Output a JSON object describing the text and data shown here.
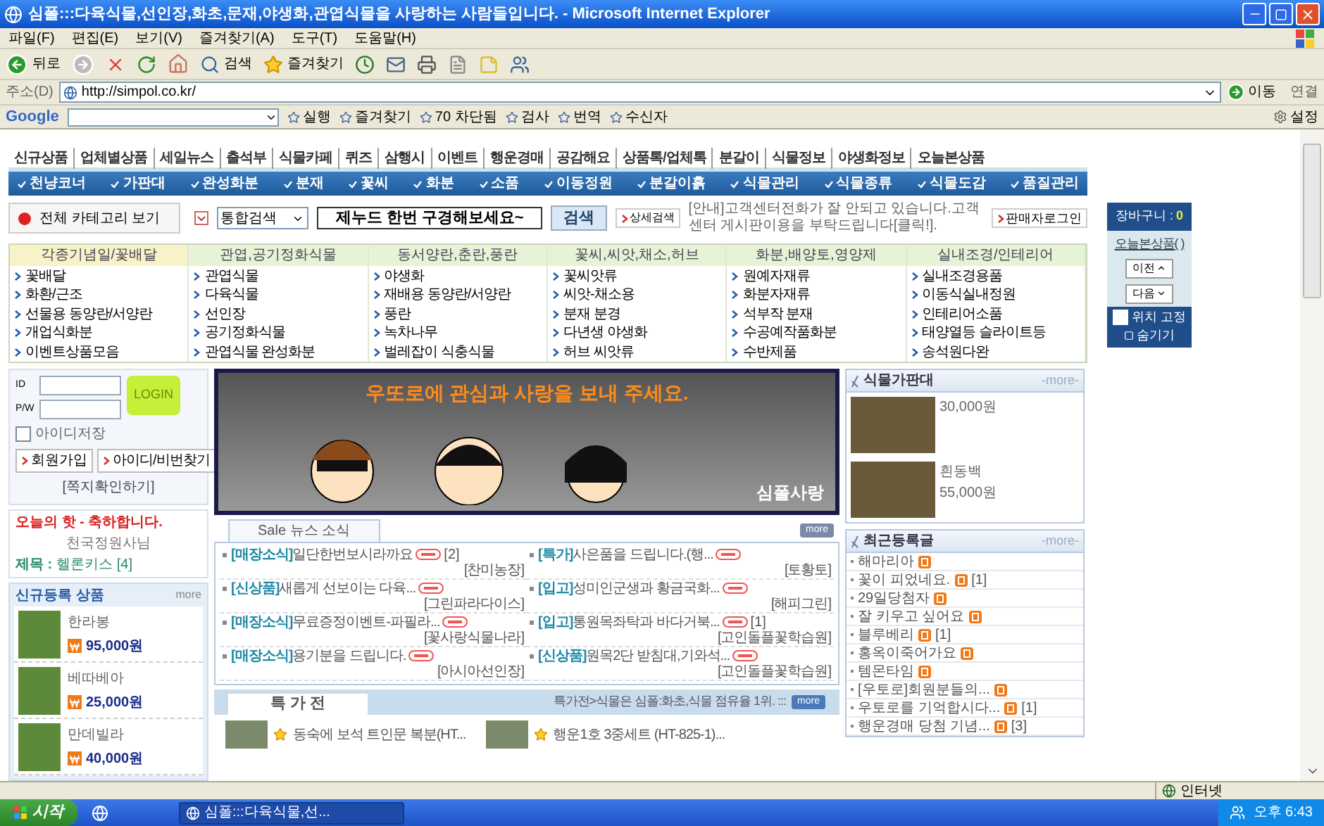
{
  "window": {
    "title": "심폴:::다육식물,선인장,화초,문재,야생화,관엽식물을 사랑하는 사람들입니다. - Microsoft Internet Explorer"
  },
  "menu": [
    "파일(F)",
    "편집(E)",
    "보기(V)",
    "즐겨찾기(A)",
    "도구(T)",
    "도움말(H)"
  ],
  "toolbar": {
    "back": "뒤로",
    "search": "검색",
    "favorites": "즐겨찾기"
  },
  "address_bar": {
    "label": "주소(D)",
    "url": "http://simpol.co.kr/",
    "go": "이동",
    "links": "연결"
  },
  "google_bar": {
    "logo": "Google",
    "items": [
      "실행",
      "즐겨찾기",
      "70 차단됨",
      "검사",
      "번역",
      "수신자"
    ],
    "settings": "설정"
  },
  "top_nav": [
    "신규상품",
    "업체별상품",
    "세일뉴스",
    "출석부",
    "식물카페",
    "퀴즈",
    "삼행시",
    "이벤트",
    "행운경매",
    "공감해요",
    "상품톡/업체톡",
    "분갈이",
    "식물정보",
    "야생화정보",
    "오늘본상품"
  ],
  "main_nav": [
    "천냥코너",
    "가판대",
    "완성화분",
    "분재",
    "꽃씨",
    "화분",
    "소품",
    "이동정원",
    "분갈이흙",
    "식물관리",
    "식물종류",
    "식물도감",
    "품질관리"
  ],
  "search": {
    "category_button": "전체 카테고리 보기",
    "scope": "통합검색",
    "value": "제누드 한번 구경해보세요~",
    "button": "검색",
    "advanced": "상세검색",
    "notice": "[안내]고객센터전화가 잘 안되고 있습니다.고객센터 게시판이용을 부탁드립니다[클릭!].",
    "seller_login": "판매자로그인"
  },
  "cart": {
    "label": "장바구니 :",
    "count": "0",
    "recent": "오늘본상품( )",
    "prev": "이전",
    "next": "다음",
    "fix_position": {
      "label": "위치 고정",
      "checked": false
    },
    "hide": "숨기기"
  },
  "categories": [
    {
      "title": "각종기념일/꽃배달",
      "items": [
        "꽃배달",
        "화환/근조",
        "선물용 동양란/서양란",
        "개업식화분",
        "이벤트상품모음"
      ]
    },
    {
      "title": "관엽,공기정화식물",
      "items": [
        "관엽식물",
        "다육식물",
        "선인장",
        "공기정화식물",
        "관엽식물 완성화분"
      ]
    },
    {
      "title": "동서양란,춘란,풍란",
      "items": [
        "야생화",
        "재배용 동양란/서양란",
        "풍란",
        "녹차나무",
        "벌레잡이 식충식물"
      ]
    },
    {
      "title": "꽃씨,씨앗,채소,허브",
      "items": [
        "꽃씨앗류",
        "씨앗-채소용",
        "분재 분경",
        "다년생 야생화",
        "허브 씨앗류"
      ]
    },
    {
      "title": "화분,배양토,영양제",
      "items": [
        "원예자재류",
        "화분자재류",
        "석부작 분재",
        "수공예작품화분",
        "수반제품"
      ]
    },
    {
      "title": "실내조경/인테리어",
      "items": [
        "실내조경용품",
        "이동식실내정원",
        "인테리어소품",
        "태양열등 슬라이트등",
        "송석원다완"
      ]
    }
  ],
  "login": {
    "id_label": "ID",
    "pw_label": "P/W",
    "button": "LOGIN",
    "remember": {
      "label": "아이디저장",
      "checked": false
    },
    "join": "회원가입",
    "find": "아이디/비번찾기",
    "messages": "[쪽지확인하기]"
  },
  "today": {
    "heading": "오늘의 핫 - 축하합니다.",
    "winner": "천국정원사님",
    "subject_label": "제목 :",
    "subject": "헬론키스 [4]"
  },
  "new_products": {
    "title": "신규등록 상품",
    "more": "more",
    "items": [
      {
        "name": "한라봉",
        "price": "95,000원"
      },
      {
        "name": "베따베아",
        "price": "25,000원"
      },
      {
        "name": "만데빌라",
        "price": "40,000원"
      }
    ]
  },
  "banner": {
    "headline": "우또로에 관심과 사랑을 보내 주세요.",
    "caption": "심폴사랑"
  },
  "news": {
    "tab": "Sale 뉴스 소식",
    "more": "more",
    "items": [
      {
        "tag": "[매장소식]",
        "text": "일단한번보시라까요",
        "new": true,
        "count": "[2]",
        "author": "[찬미농장]"
      },
      {
        "tag": "[특가]",
        "text": "사은품을 드립니다.(행...",
        "new": true,
        "author": "[토황토]"
      },
      {
        "tag": "[신상품]",
        "text": "새롭게 선보이는 다육...",
        "new": true,
        "author": "[그린파라다이스]"
      },
      {
        "tag": "[입고]",
        "text": "성미인군생과 황금국화...",
        "new": true,
        "author": "[해피그린]"
      },
      {
        "tag": "[매장소식]",
        "text": "무료증정이벤트-파필라...",
        "new": true,
        "author": "[꽃사랑식물나라]"
      },
      {
        "tag": "[입고]",
        "text": "통원목좌탁과 바다거북...",
        "new": true,
        "count": "[1]",
        "author": "[고인돌플꽃학습원]"
      },
      {
        "tag": "[매장소식]",
        "text": "용기분을 드립니다.",
        "new": true,
        "author": "[아시아선인장]"
      },
      {
        "tag": "[신상품]",
        "text": "원목2단 받침대,기와석...",
        "new": true,
        "author": "[고인돌플꽃학습원]"
      }
    ]
  },
  "special": {
    "title": "특 가 전",
    "ticker": "특가전>식물은 심폴:화초,식물 점유율 1위. :::",
    "more": "more",
    "items": [
      {
        "name": "동숙에 보석 트인문 복분(HT..."
      },
      {
        "name": "행운1호 3중세트 (HT-825-1)..."
      }
    ]
  },
  "plant_stand": {
    "title": "식물가판대",
    "more": "-more-",
    "items": [
      {
        "price": "30,000원"
      },
      {
        "name": "흰동백",
        "price": "55,000원"
      }
    ]
  },
  "recent_posts": {
    "title": "최근등록글",
    "more": "-more-",
    "items": [
      {
        "text": "해마리아",
        "new": true
      },
      {
        "text": "꽃이 피었네요.",
        "new": true,
        "count": "[1]"
      },
      {
        "text": "29일당첨자",
        "new": true
      },
      {
        "text": "잘 키우고 싶어요",
        "new": true
      },
      {
        "text": "블루베리",
        "new": true,
        "count": "[1]"
      },
      {
        "text": "홍옥이죽어가요",
        "new": true
      },
      {
        "text": "템몬타임",
        "new": true
      },
      {
        "text": "[우토로]회원분들의...",
        "new": true
      },
      {
        "text": "우토로를 기억합시다...",
        "new": true,
        "count": "[1]"
      },
      {
        "text": "행운경매 당첨 기념...",
        "new": true,
        "count": "[3]"
      }
    ]
  },
  "status_bar": {
    "zone": "인터넷"
  },
  "taskbar": {
    "start": "시작",
    "task": "심폴:::다육식물,선...",
    "clock": "오후 6:43"
  }
}
